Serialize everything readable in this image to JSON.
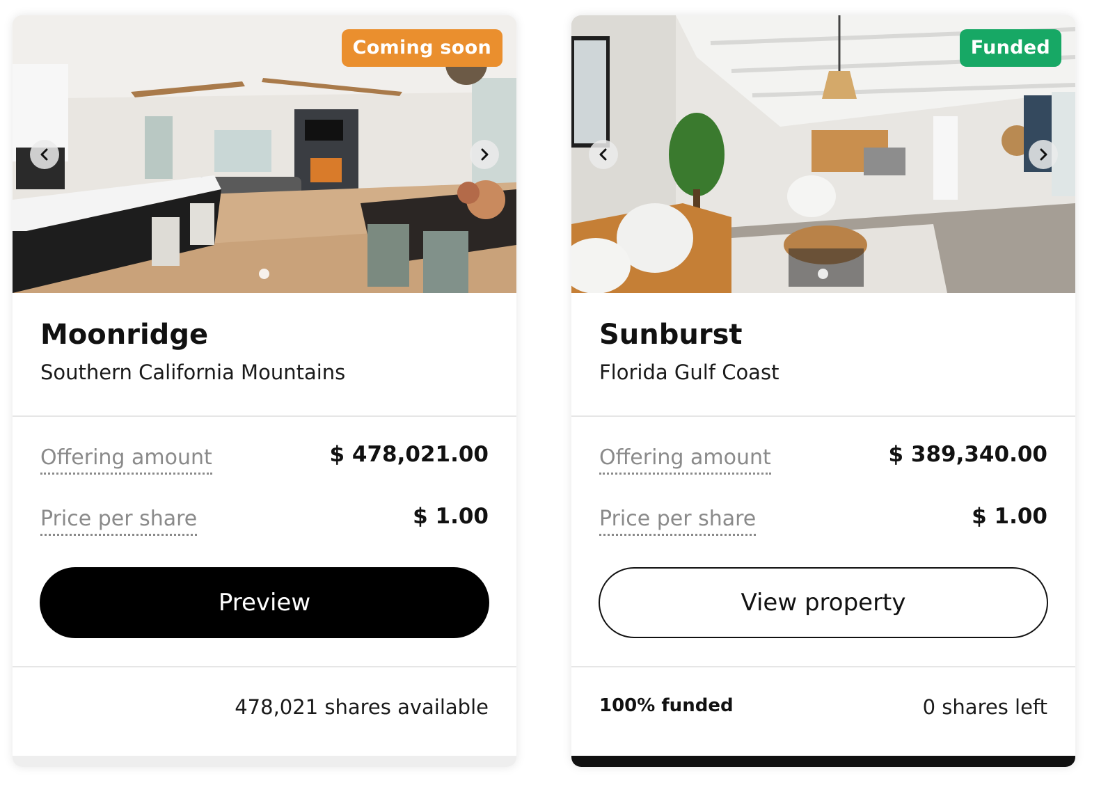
{
  "properties": [
    {
      "name": "Moonridge",
      "location": "Southern California Mountains",
      "badge": "Coming soon",
      "badge_color": "#ea8f2e",
      "offering_label": "Offering amount",
      "offering_value": "$ 478,021.00",
      "price_label": "Price per share",
      "price_value": "$ 1.00",
      "button_label": "Preview",
      "footer_left": "",
      "footer_right": "478,021 shares available",
      "photo_icon": "kitchen-living-room-photo"
    },
    {
      "name": "Sunburst",
      "location": "Florida Gulf Coast",
      "badge": "Funded",
      "badge_color": "#17a865",
      "offering_label": "Offering amount",
      "offering_value": "$ 389,340.00",
      "price_label": "Price per share",
      "price_value": "$ 1.00",
      "button_label": "View property",
      "footer_left": "100% funded",
      "footer_right": "0 shares left",
      "photo_icon": "living-room-photo"
    }
  ]
}
